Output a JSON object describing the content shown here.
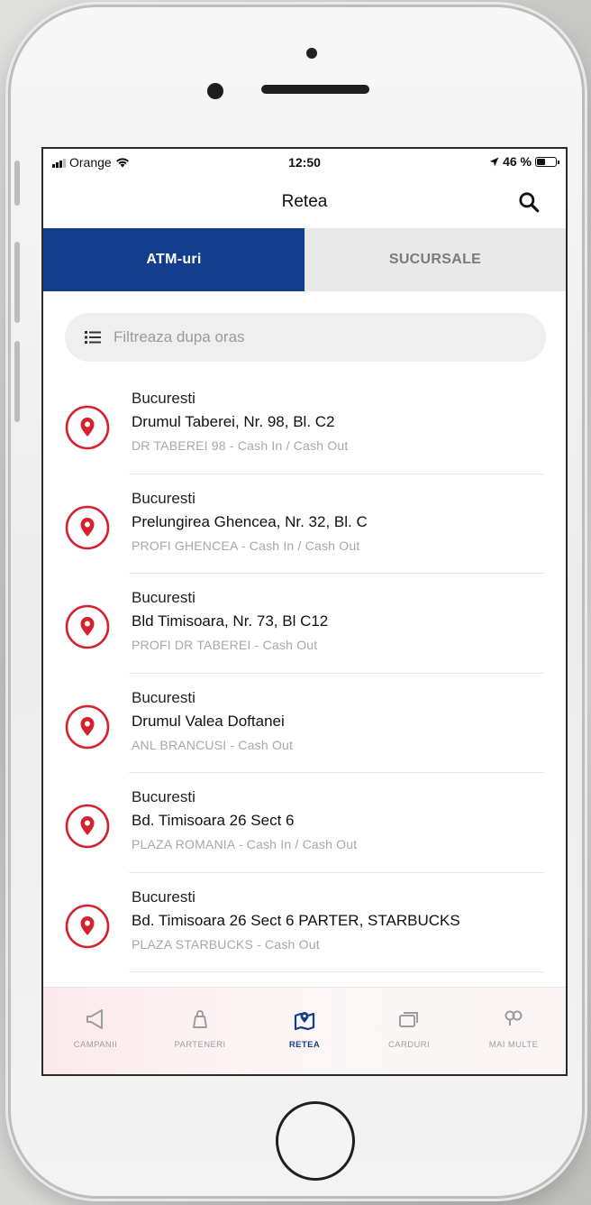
{
  "status_bar": {
    "carrier": "Orange",
    "time": "12:50",
    "battery": "46 %",
    "battery_level": 0.46
  },
  "header": {
    "title": "Retea",
    "search_icon": "search-icon"
  },
  "tabs": [
    {
      "label": "ATM-uri",
      "active": true
    },
    {
      "label": "SUCURSALE",
      "active": false
    }
  ],
  "filter": {
    "placeholder": "Filtreaza dupa oras",
    "value": "",
    "icon": "list-icon"
  },
  "atms": [
    {
      "city": "Bucuresti",
      "address": "Drumul Taberei, Nr. 98, Bl. C2",
      "details": "DR TABEREI 98 - Cash In / Cash Out"
    },
    {
      "city": "Bucuresti",
      "address": "Prelungirea Ghencea, Nr. 32, Bl. C",
      "details": "PROFI GHENCEA - Cash In / Cash Out"
    },
    {
      "city": "Bucuresti",
      "address": "Bld Timisoara, Nr. 73, Bl C12",
      "details": "PROFI DR TABEREI - Cash Out"
    },
    {
      "city": "Bucuresti",
      "address": "Drumul Valea Doftanei",
      "details": "ANL BRANCUSI - Cash Out"
    },
    {
      "city": "Bucuresti",
      "address": "Bd. Timisoara 26 Sect 6",
      "details": "PLAZA ROMANIA - Cash In / Cash Out"
    },
    {
      "city": "Bucuresti",
      "address": "Bd. Timisoara 26 Sect 6 PARTER, STARBUCKS",
      "details": "PLAZA STARBUCKS - Cash Out"
    }
  ],
  "tab_bar": [
    {
      "label": "CAMPANII",
      "icon": "megaphone-icon",
      "active": false
    },
    {
      "label": "PARTENERI",
      "icon": "shopping-bag-icon",
      "active": false
    },
    {
      "label": "RETEA",
      "icon": "map-pin-icon",
      "active": true
    },
    {
      "label": "CARDURI",
      "icon": "cards-icon",
      "active": false
    },
    {
      "label": "MAI MULTE",
      "icon": "more-icon",
      "active": false
    }
  ],
  "colors": {
    "primary_blue": "#123e8c",
    "pin_red": "#d6202e",
    "inactive_tab": "#e9e9e9",
    "muted_text": "#a8a8a8"
  }
}
